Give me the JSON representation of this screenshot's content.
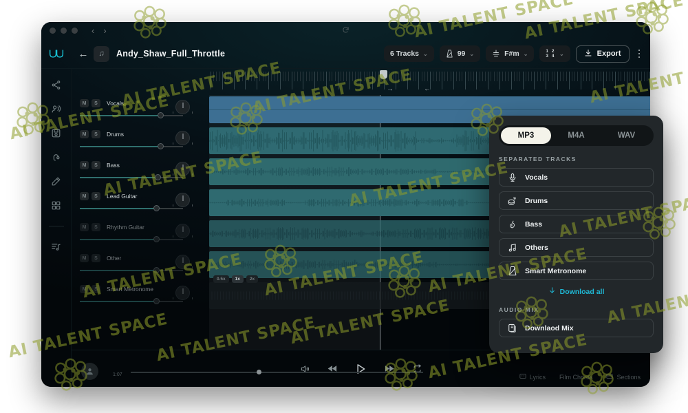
{
  "titlebar": {
    "nav_back": "‹",
    "nav_forward": "›",
    "reload_icon": "reload-icon"
  },
  "header": {
    "logo_icon": "moises-wave-logo",
    "back_label": "←",
    "song_chip_icon": "music-note-icon",
    "song_title": "Andy_Shaw_Full_Throttle",
    "tracks_count": "6 Tracks",
    "bpm": "99",
    "key": "F#m",
    "time_signature_top": "1 2",
    "time_signature_bottom": "3 4",
    "export_label": "Export",
    "chevron": "⌄",
    "kebab_name": "more-options"
  },
  "rail": {
    "items": [
      {
        "name": "share-icon"
      },
      {
        "name": "voice-icon"
      },
      {
        "name": "save-icon"
      },
      {
        "name": "headphone-icon"
      },
      {
        "name": "edit-pencil-icon"
      },
      {
        "name": "grid-icon"
      },
      {
        "name": "playlist-music-icon"
      }
    ]
  },
  "tracks": [
    {
      "name": "Vocals",
      "mute": "M",
      "solo": "S",
      "volume": 78,
      "color": "#3d6f93",
      "wave": "none"
    },
    {
      "name": "Drums",
      "mute": "M",
      "solo": "S",
      "volume": 78,
      "color": "#2f6a72",
      "wave": "dense"
    },
    {
      "name": "Bass",
      "mute": "M",
      "solo": "S",
      "volume": 75,
      "color": "#2f6a6e",
      "wave": "low"
    },
    {
      "name": "Lead Guitar",
      "mute": "M",
      "solo": "S",
      "volume": 74,
      "color": "#2f6a70",
      "wave": "sparse"
    },
    {
      "name": "Rhythm Guitar",
      "mute": "M",
      "solo": "S",
      "volume": 74,
      "color": "#2f6d72",
      "wave": "mid"
    },
    {
      "name": "Other",
      "mute": "M",
      "solo": "S",
      "volume": 74,
      "color": "#2f6a6e",
      "wave": "low"
    },
    {
      "name": "Smart Metronome",
      "mute": "M",
      "solo": "S",
      "volume": 74,
      "color": "#151b1e",
      "wave": "ticks"
    }
  ],
  "metronome_badges": [
    {
      "label": "0.5x",
      "active": false
    },
    {
      "label": "1x",
      "active": true
    },
    {
      "label": "2x",
      "active": false
    }
  ],
  "transport": {
    "volume_icon": "volume-icon",
    "rewind_icon": "rewind-icon",
    "play_icon": "play-icon",
    "forward_icon": "forward-icon",
    "loop_icon": "loop-icon",
    "time_label": "1:07",
    "tabs": [
      {
        "label": "Lyrics",
        "icon": "lyrics-icon"
      },
      {
        "label": "Film Chords",
        "icon": "chords-icon"
      },
      {
        "label": "Sections",
        "icon": "sections-icon"
      }
    ]
  },
  "export_panel": {
    "formats": [
      {
        "label": "MP3",
        "active": true
      },
      {
        "label": "M4A",
        "active": false
      },
      {
        "label": "WAV",
        "active": false
      }
    ],
    "separated_label": "SEPARATED TRACKS",
    "separated_tracks": [
      {
        "label": "Vocals",
        "icon": "microphone-icon"
      },
      {
        "label": "Drums",
        "icon": "drum-icon"
      },
      {
        "label": "Bass",
        "icon": "bass-guitar-icon"
      },
      {
        "label": "Others",
        "icon": "music-note-icon"
      },
      {
        "label": "Smart Metronome",
        "icon": "metronome-icon"
      }
    ],
    "download_all": "Download all",
    "download_all_icon": "download-arrow-icon",
    "audio_mix_label": "AUDIO MIX",
    "download_mix": "Downlaod Mix",
    "download_mix_icon": "stacked-files-icon",
    "accent_color": "#1fb9d6"
  },
  "watermark": {
    "text": "AI TALENT SPACE",
    "color": "#8f9e2a"
  }
}
